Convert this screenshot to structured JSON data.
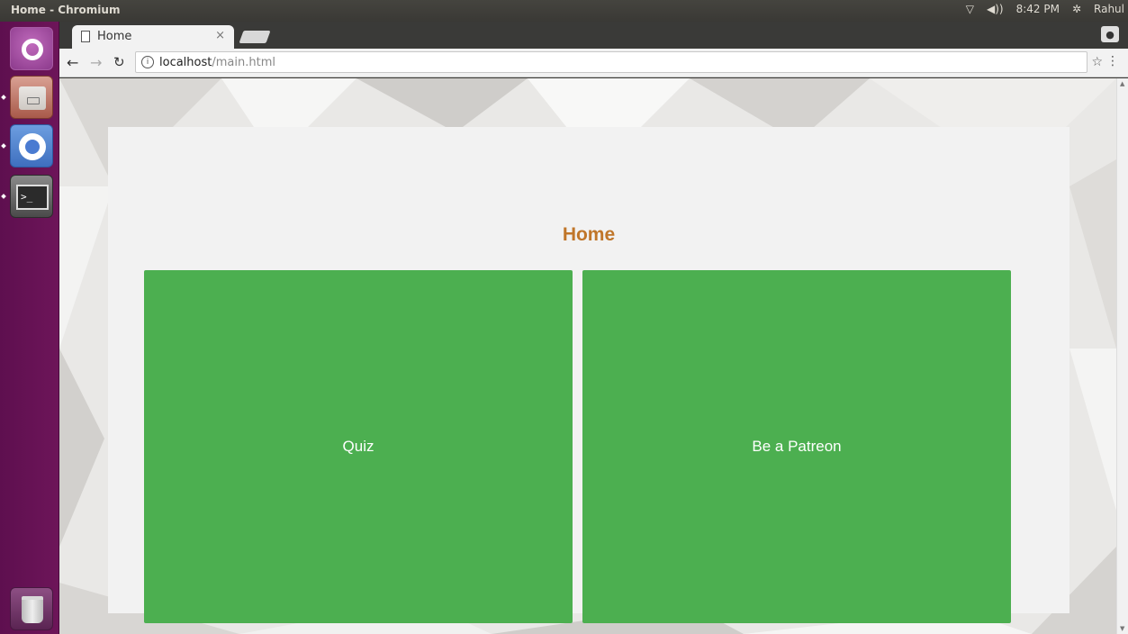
{
  "system_bar": {
    "window_title": "Home - Chromium",
    "time": "8:42 PM",
    "user": "Rahul"
  },
  "browser": {
    "tab_title": "Home",
    "tab_close": "×",
    "url_host": "localhost",
    "url_path": "/main.html"
  },
  "page": {
    "title": "Home",
    "buttons": [
      {
        "label": "Quiz"
      },
      {
        "label": "Be a Patreon"
      }
    ]
  },
  "colors": {
    "accent_title": "#c0762a",
    "tile_green": "#4caf50",
    "launcher": "#6d1559"
  }
}
